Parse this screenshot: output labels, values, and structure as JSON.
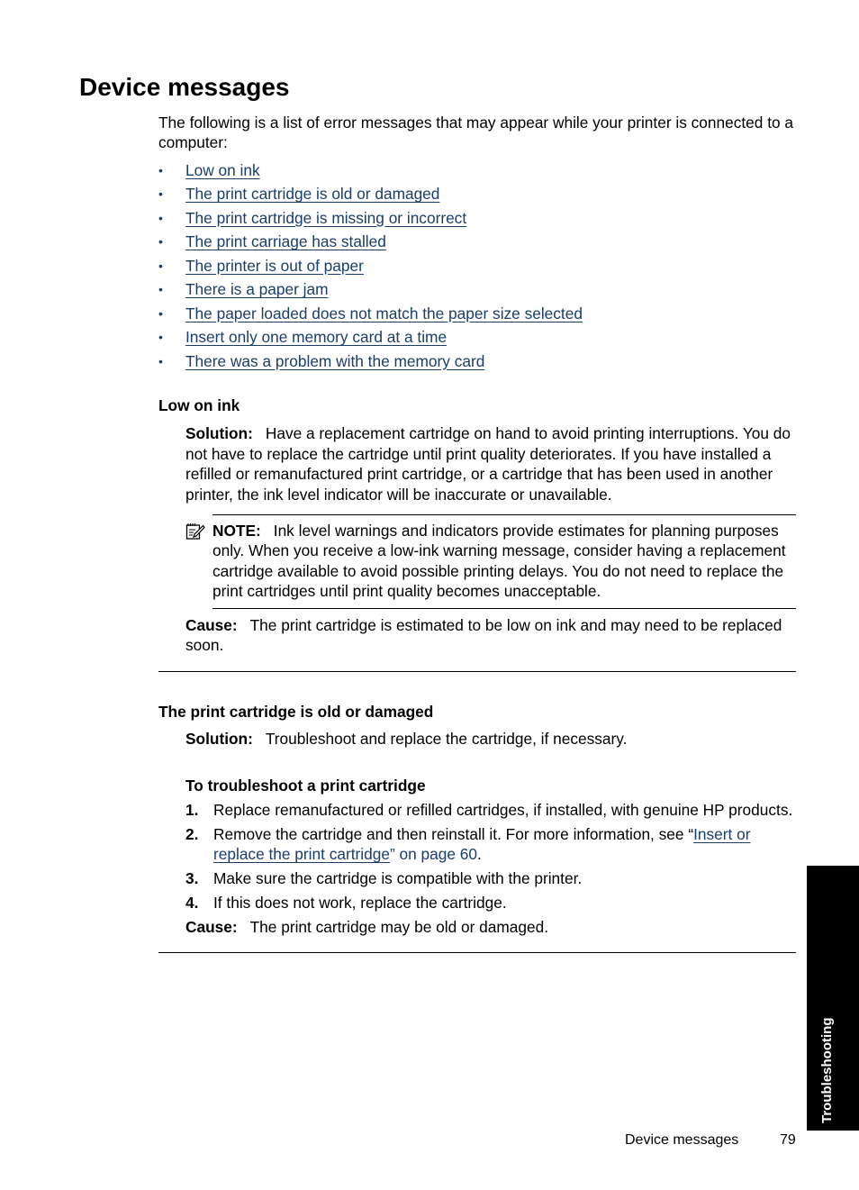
{
  "page": {
    "title": "Device messages",
    "intro": "The following is a list of error messages that may appear while your printer is connected to a computer:",
    "toc": [
      "Low on ink",
      "The print cartridge is old or damaged",
      "The print cartridge is missing or incorrect",
      "The print carriage has stalled",
      "The printer is out of paper",
      "There is a paper jam",
      "The paper loaded does not match the paper size selected",
      "Insert only one memory card at a time",
      "There was a problem with the memory card"
    ],
    "bullet": "•"
  },
  "sections": {
    "low_ink": {
      "heading": "Low on ink",
      "solution_label": "Solution:",
      "solution_text": "Have a replacement cartridge on hand to avoid printing interruptions. You do not have to replace the cartridge until print quality deteriorates. If you have installed a refilled or remanufactured print cartridge, or a cartridge that has been used in another printer, the ink level indicator will be inaccurate or unavailable.",
      "note_label": "NOTE:",
      "note_text": "Ink level warnings and indicators provide estimates for planning purposes only. When you receive a low-ink warning message, consider having a replacement cartridge available to avoid possible printing delays. You do not need to replace the print cartridges until print quality becomes unacceptable.",
      "note_icon": "note-pencil-icon",
      "cause_label": "Cause:",
      "cause_text": "The print cartridge is estimated to be low on ink and may need to be replaced soon."
    },
    "old_damaged": {
      "heading": "The print cartridge is old or damaged",
      "solution_label": "Solution:",
      "solution_text": "Troubleshoot and replace the cartridge, if necessary.",
      "procedure_title": "To troubleshoot a print cartridge",
      "steps": [
        {
          "num": "1.",
          "text": "Replace remanufactured or refilled cartridges, if installed, with genuine HP products."
        },
        {
          "num": "2.",
          "text_before": "Remove the cartridge and then reinstall it. For more information, see “",
          "link": "Insert or replace the print cartridge",
          "text_after_link": "” on page 60",
          "end": "."
        },
        {
          "num": "3.",
          "text": "Make sure the cartridge is compatible with the printer."
        },
        {
          "num": "4.",
          "text": "If this does not work, replace the cartridge."
        }
      ],
      "cause_label": "Cause:",
      "cause_text": "The print cartridge may be old or damaged."
    }
  },
  "side_tab": {
    "label": "Troubleshooting"
  },
  "footer": {
    "section": "Device messages",
    "page_number": "79"
  },
  "colors": {
    "link": "#1a3d6e",
    "text": "#000000",
    "tab_bg": "#000000"
  }
}
